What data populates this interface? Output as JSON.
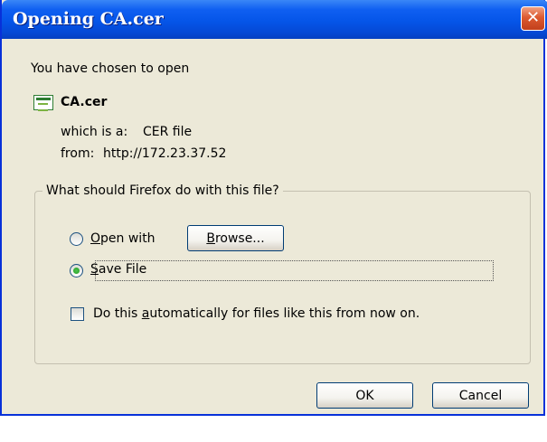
{
  "window": {
    "title": "Opening CA.cer"
  },
  "icons": {
    "close": "close-icon",
    "file": "certificate-file-icon"
  },
  "content": {
    "intro": "You have chosen to open",
    "filename": "CA.cer",
    "type_label": "which is a:",
    "type_value": "CER file",
    "from_label": "from:",
    "from_value": "http://172.23.37.52"
  },
  "actions": {
    "legend": "What should Firefox do with this file?",
    "open_with": {
      "first": "O",
      "rest": "pen with",
      "selected": false
    },
    "browse": {
      "first": "B",
      "rest": "rowse..."
    },
    "save_file": {
      "first": "S",
      "rest": "ave File",
      "selected": true
    },
    "auto": {
      "before": "Do this ",
      "accel": "a",
      "after": "utomatically for files like this from now on.",
      "checked": false
    }
  },
  "buttons": {
    "ok": "OK",
    "cancel": "Cancel"
  },
  "colors": {
    "titlebar": "#0555e8",
    "dialog_bg": "#ece9d8",
    "close": "#dc5a30"
  }
}
